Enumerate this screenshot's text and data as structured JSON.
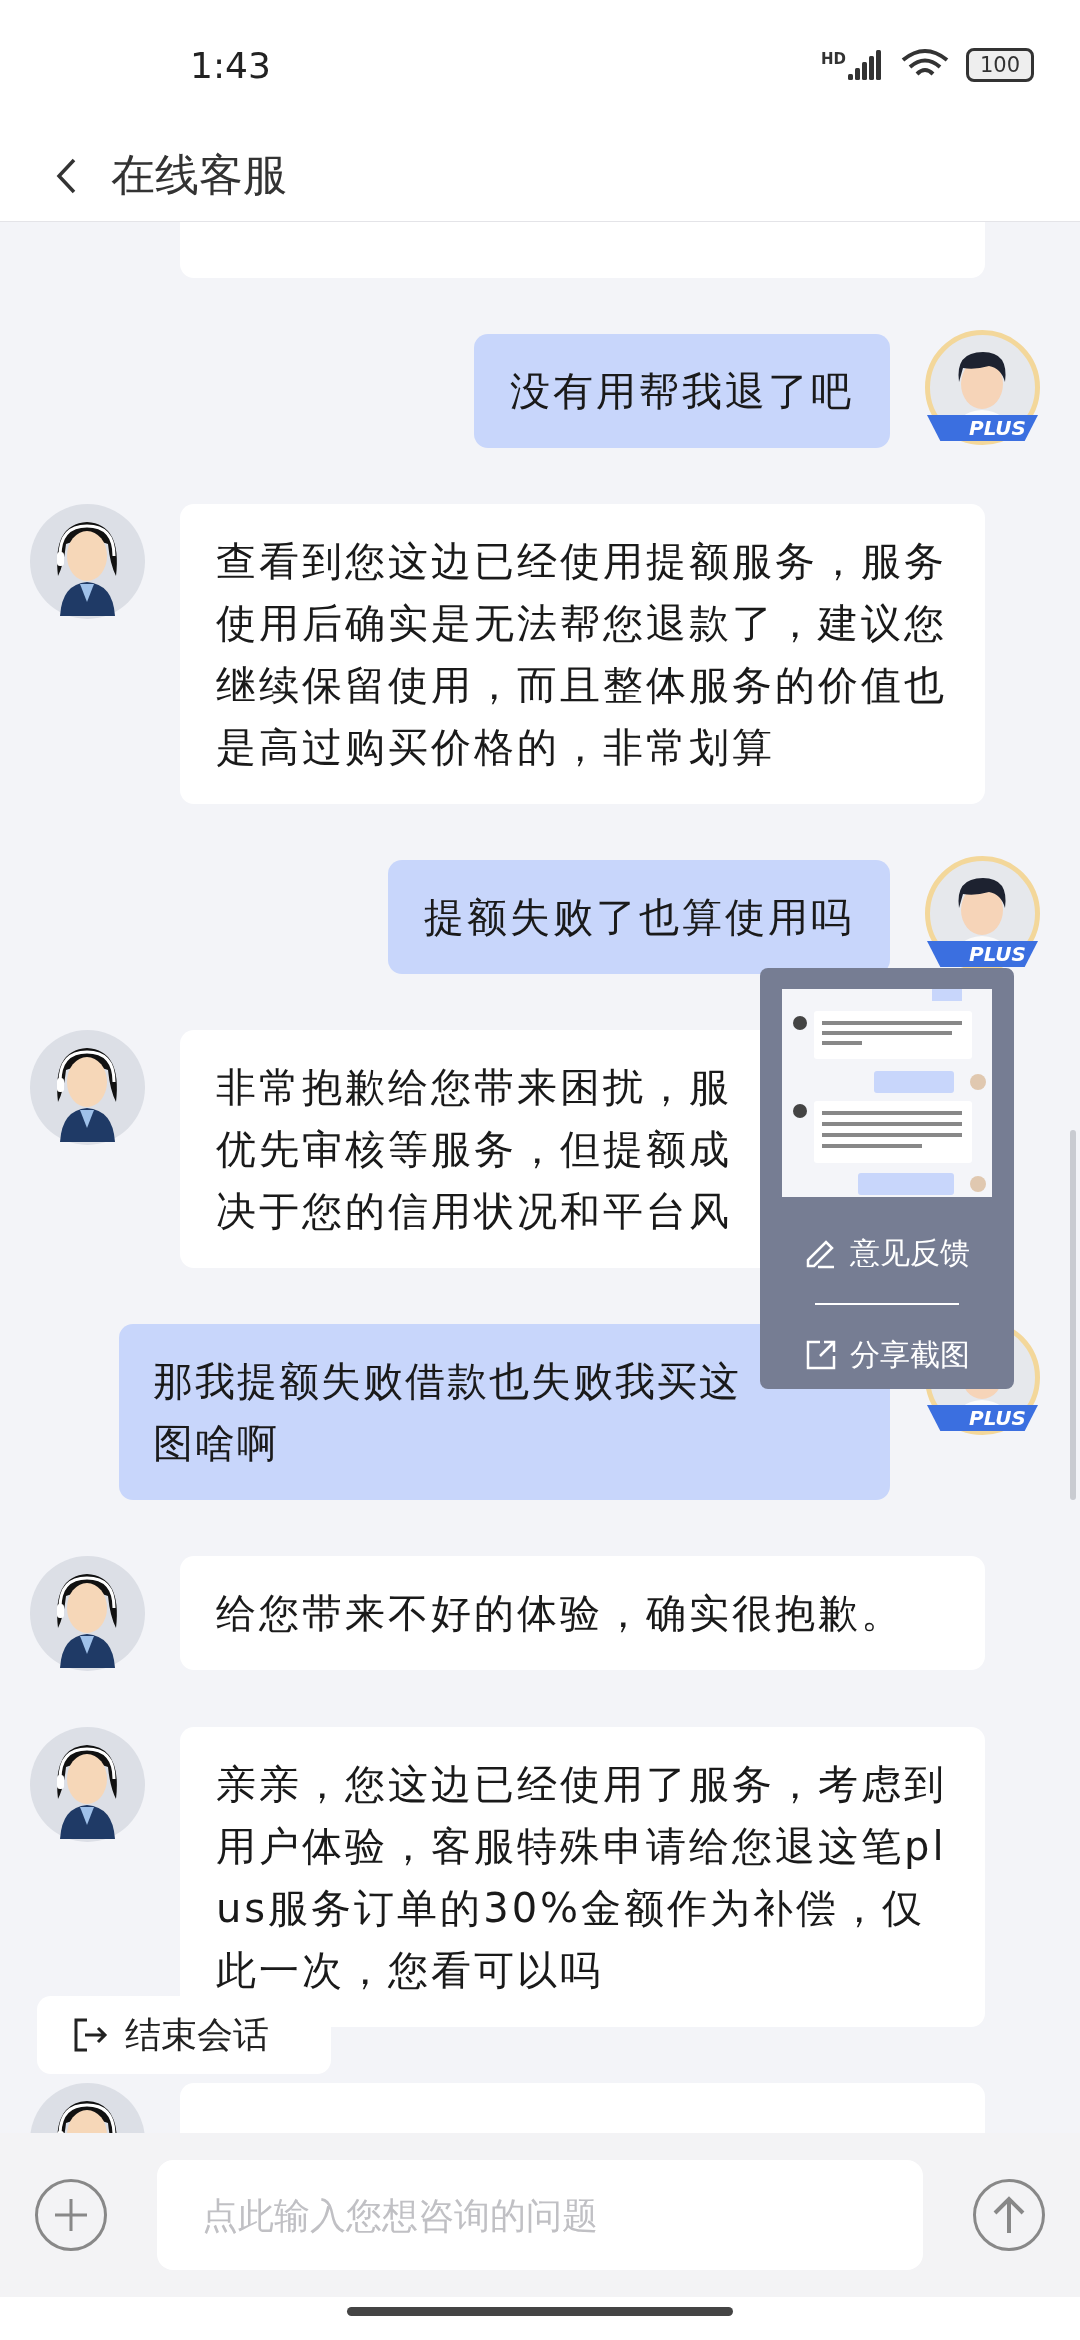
{
  "status_bar": {
    "time": "1:43",
    "network": "HD",
    "battery": "100"
  },
  "header": {
    "title": "在线客服"
  },
  "messages": [
    {
      "kind": "clipped"
    },
    {
      "kind": "user",
      "text": "没有用帮我退了吧",
      "badge": "PLUS"
    },
    {
      "kind": "agent",
      "text": "查看到您这边已经使用提额服务，服务使用后确实是无法帮您退款了，建议您继续保留使用，而且整体服务的价值也是高过购买价格的，非常划算"
    },
    {
      "kind": "user",
      "text": "提额失败了也算使用吗",
      "badge": "PLUS"
    },
    {
      "kind": "agent",
      "lines": [
        "非常抱歉给您带来困扰，服",
        "优先审核等服务，但提额成",
        "决于您的信用状况和平台风"
      ]
    },
    {
      "kind": "user",
      "lines": [
        "那我提额失败借款也失败我买这",
        "图啥啊"
      ],
      "badge": "PLUS"
    },
    {
      "kind": "agent",
      "text": "给您带来不好的体验，确实很抱歉。"
    },
    {
      "kind": "agent",
      "text": "亲亲，您这边已经使用了服务，考虑到用户体验，客服特殊申请给您退这笔plus服务订单的30%金额作为补偿，仅此一次，您看可以吗"
    },
    {
      "kind": "agent"
    }
  ],
  "popup": {
    "items": [
      {
        "kind": "feedback",
        "label": "意见反馈"
      },
      {
        "kind": "share",
        "label": "分享截图"
      }
    ]
  },
  "end_session": {
    "label": "结束会话"
  },
  "composer": {
    "placeholder": "点此输入您想咨询的问题"
  }
}
